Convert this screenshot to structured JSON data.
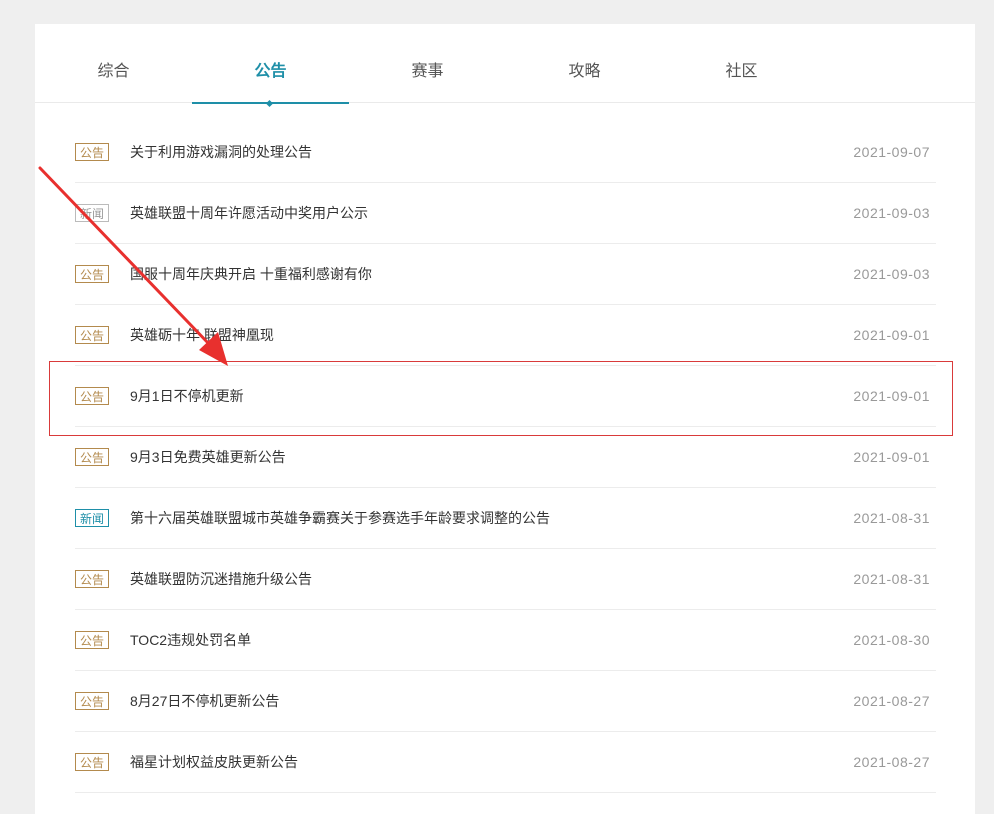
{
  "tabs": [
    {
      "label": "综合"
    },
    {
      "label": "公告"
    },
    {
      "label": "赛事"
    },
    {
      "label": "攻略"
    },
    {
      "label": "社区"
    }
  ],
  "active_tab": "公告",
  "articles": [
    {
      "tag": "公告",
      "title": "关于利用游戏漏洞的处理公告",
      "date": "2021-09-07"
    },
    {
      "tag": "新闻",
      "title": "英雄联盟十周年许愿活动中奖用户公示",
      "date": "2021-09-03"
    },
    {
      "tag": "公告",
      "title": "国服十周年庆典开启 十重福利感谢有你",
      "date": "2021-09-03"
    },
    {
      "tag": "公告",
      "title": "英雄砺十年 联盟神凰现",
      "date": "2021-09-01"
    },
    {
      "tag": "公告",
      "title": "9月1日不停机更新",
      "date": "2021-09-01"
    },
    {
      "tag": "公告",
      "title": "9月3日免费英雄更新公告",
      "date": "2021-09-01"
    },
    {
      "tag": "新闻",
      "title": "第十六届英雄联盟城市英雄争霸赛关于参赛选手年龄要求调整的公告",
      "date": "2021-08-31"
    },
    {
      "tag": "公告",
      "title": "英雄联盟防沉迷措施升级公告",
      "date": "2021-08-31"
    },
    {
      "tag": "公告",
      "title": "TOC2违规处罚名单",
      "date": "2021-08-30"
    },
    {
      "tag": "公告",
      "title": "8月27日不停机更新公告",
      "date": "2021-08-27"
    },
    {
      "tag": "公告",
      "title": "福星计划权益皮肤更新公告",
      "date": "2021-08-27"
    }
  ],
  "colors": {
    "accent": "#1e8fa8",
    "announcement_tag": "#b38a4d",
    "annotation_red": "#d93a3a"
  },
  "annotation": {
    "highlighted_item": "9月1日不停机更新",
    "icon": "red-arrow-icon"
  }
}
